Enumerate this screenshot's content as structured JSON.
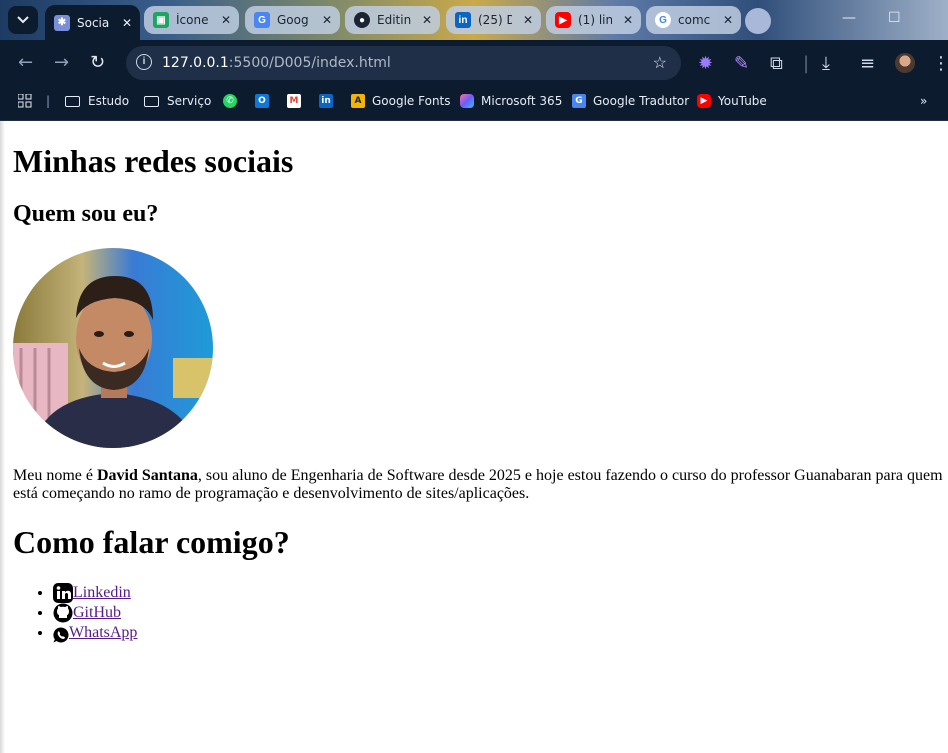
{
  "browser": {
    "tabs": [
      {
        "title": "Socia",
        "active": true,
        "favicon_color": "#7b8fd8"
      },
      {
        "title": "Ícone",
        "active": false,
        "favicon_color": "#1fa463"
      },
      {
        "title": "Goog",
        "active": false,
        "favicon_color": "#4a86f0"
      },
      {
        "title": "Editin",
        "active": false,
        "favicon_color": "#1b2430"
      },
      {
        "title": "(25) D",
        "active": false,
        "favicon_color": "#0a66c2"
      },
      {
        "title": "(1) lin",
        "active": false,
        "favicon_color": "#ff0000"
      },
      {
        "title": "comc",
        "active": false,
        "favicon_color": "#ffffff"
      }
    ],
    "address": {
      "host": "127.0.0.1",
      "path": ":5500/D005/index.html"
    },
    "bookmarks": [
      "Estudo",
      "Serviço",
      "Google Fonts",
      "Microsoft 365",
      "Google Tradutor",
      "YouTube"
    ],
    "colors": {
      "chrome_dark": "#0d1b2e",
      "omnibox": "#1f2f47"
    }
  },
  "page": {
    "title": "Minhas redes sociais",
    "about_heading": "Quem sou eu?",
    "bio_prefix": "Meu nome é ",
    "bio_name": "David Santana",
    "bio_suffix": ", sou aluno de Engenharia de Software desde 2025 e hoje estou fazendo o curso do professor Guanabaran para quem está começando no ramo de programação e desenvolvimento de sites/aplicações.",
    "contact_heading": "Como falar comigo?",
    "links": [
      {
        "label": "Linkedin",
        "icon": "linkedin-icon"
      },
      {
        "label": "GitHub",
        "icon": "github-icon"
      },
      {
        "label": "WhatsApp",
        "icon": "whatsapp-icon"
      }
    ],
    "colors": {
      "link_visited": "#551a8b"
    }
  }
}
